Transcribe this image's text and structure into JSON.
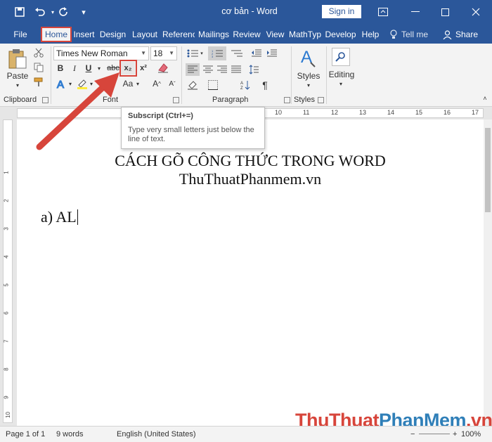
{
  "window": {
    "title": "cơ bản  -  Word",
    "sign_in": "Sign in"
  },
  "tabs": [
    {
      "label": "File"
    },
    {
      "label": "Home"
    },
    {
      "label": "Insert"
    },
    {
      "label": "Design"
    },
    {
      "label": "Layout"
    },
    {
      "label": "Referenc"
    },
    {
      "label": "Mailings"
    },
    {
      "label": "Review"
    },
    {
      "label": "View"
    },
    {
      "label": "MathTyp"
    },
    {
      "label": "Develop"
    },
    {
      "label": "Help"
    }
  ],
  "tell_me": "Tell me",
  "share": "Share",
  "ribbon": {
    "paste": "Paste",
    "font_name": "Times New Roman",
    "font_size": "18",
    "bold": "B",
    "italic": "I",
    "underline": "U",
    "strike": "abc",
    "subscript": "x₂",
    "superscript": "x²",
    "change_case": "Aa",
    "styles": "Styles",
    "editing": "Editing",
    "groups": {
      "clipboard": "Clipboard",
      "font": "Font",
      "paragraph": "Paragraph",
      "styles": "Styles"
    }
  },
  "tooltip": {
    "title": "Subscript (Ctrl+=)",
    "body": "Type very small letters just below the line of text."
  },
  "ruler": {
    "numbers": [
      "10",
      "11",
      "12",
      "13",
      "14",
      "15",
      "16",
      "17"
    ],
    "vertical": [
      "1",
      "2",
      "3",
      "4",
      "5",
      "6",
      "7",
      "8",
      "9",
      "10"
    ]
  },
  "document": {
    "line1": "CÁCH GÕ CÔNG THỨC TRONG WORD",
    "line2": "ThuThuatPhanmem.vn",
    "line3": "a) AL"
  },
  "status": {
    "page": "Page 1 of 1",
    "words": "9 words",
    "language": "English (United States)",
    "zoom": "100%"
  },
  "watermark": {
    "part1": "ThuThuat",
    "part2": "PhanMem",
    "part3": ".vn"
  },
  "colors": {
    "accent": "#2b579a",
    "highlight": "#d7453b"
  }
}
